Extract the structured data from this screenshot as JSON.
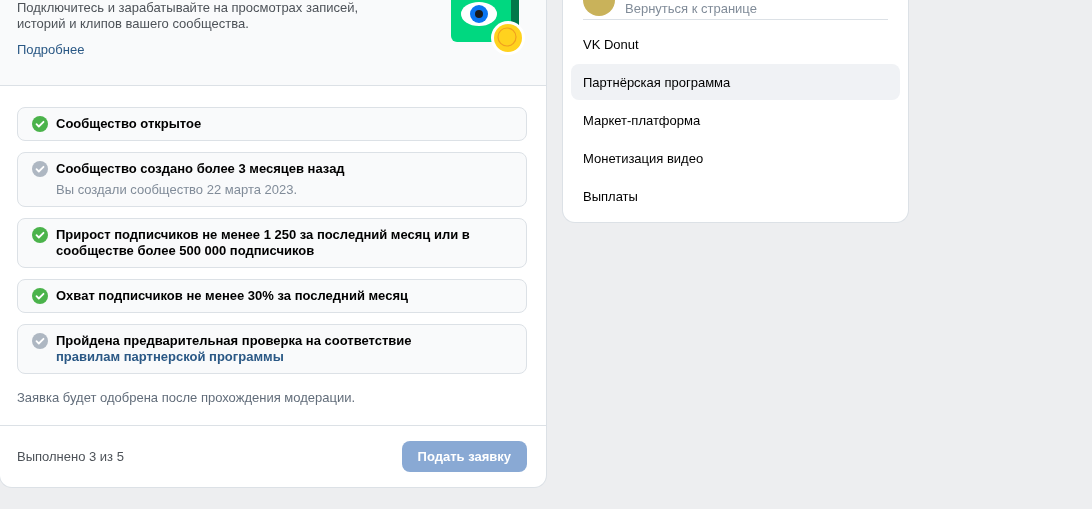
{
  "program_card": {
    "description": "Подключитесь и зарабатывайте на просмотрах записей, историй и клипов вашего сообщества.",
    "more_link": "Подробнее",
    "requirements": [
      {
        "text": "Сообщество открытое",
        "done": true
      },
      {
        "text": "Сообщество создано более 3 месяцев назад",
        "note": "Вы создали сообщество 22 марта 2023.",
        "done": false
      },
      {
        "text": "Прирост подписчиков не менее 1 250 за последний месяц или в сообществе более 500 000 подписчиков",
        "done": true
      },
      {
        "text": "Охват подписчиков не менее 30% за последний месяц",
        "done": true
      },
      {
        "text": "Пройдена предварительная проверка на соответствие",
        "link": "правилам партнерской программы",
        "done": false
      }
    ],
    "moderation_note": "Заявка будет одобрена после прохождения модерации.",
    "progress": "Выполнено 3 из 5",
    "submit_button": {
      "label": "Подать заявку",
      "disabled": true
    }
  },
  "side_menu": {
    "back_link": "Вернуться к странице",
    "items": [
      {
        "label": "VK Donut",
        "selected": false
      },
      {
        "label": "Партнёрская программа",
        "selected": true
      },
      {
        "label": "Маркет-платформа",
        "selected": false
      },
      {
        "label": "Монетизация видео",
        "selected": false
      },
      {
        "label": "Выплаты",
        "selected": false
      }
    ]
  }
}
